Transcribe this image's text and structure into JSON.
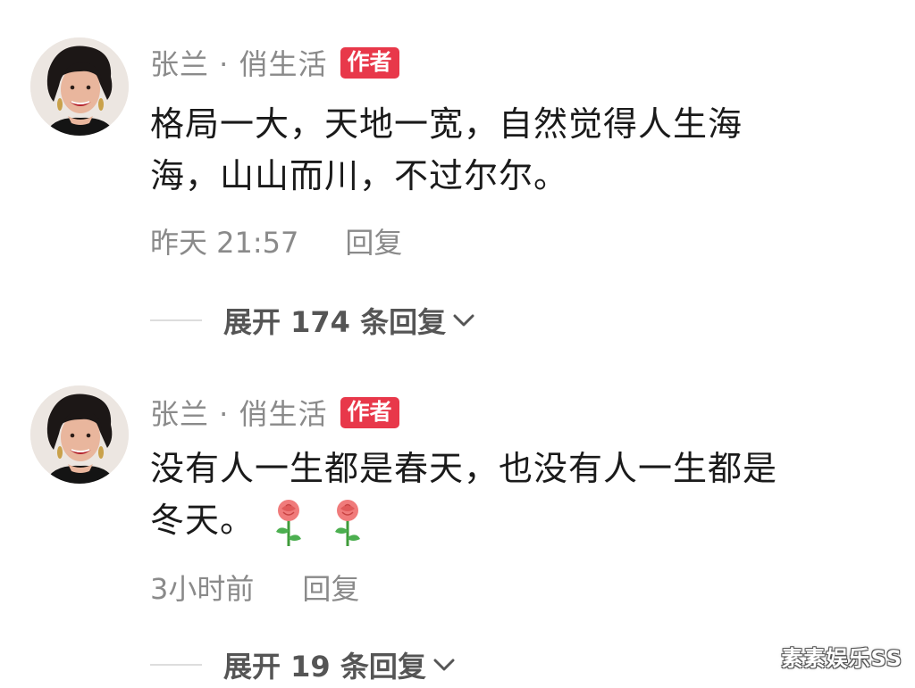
{
  "comments": [
    {
      "username": "张兰 · 俏生活",
      "badge": "作者",
      "text_line1": "格局一大，天地一宽，自然觉得人生海",
      "text_line2": "海，山山而川，不过尔尔。",
      "timestamp": "昨天 21:57",
      "reply_label": "回复",
      "expand_label": "展开 174 条回复"
    },
    {
      "username": "张兰 · 俏生活",
      "badge": "作者",
      "text_line1": "没有人一生都是春天，也没有人一生都是",
      "text_line2": "冬天。",
      "emojis": [
        "rose-icon",
        "rose-icon"
      ],
      "timestamp": "3小时前",
      "reply_label": "回复",
      "expand_label": "展开 19 条回复"
    }
  ],
  "watermark": "素素娱乐SS",
  "colors": {
    "badge_bg": "#e8384a",
    "meta_text": "#8a8a8a",
    "body_text": "#1a1a1a",
    "expand_text": "#555555"
  }
}
